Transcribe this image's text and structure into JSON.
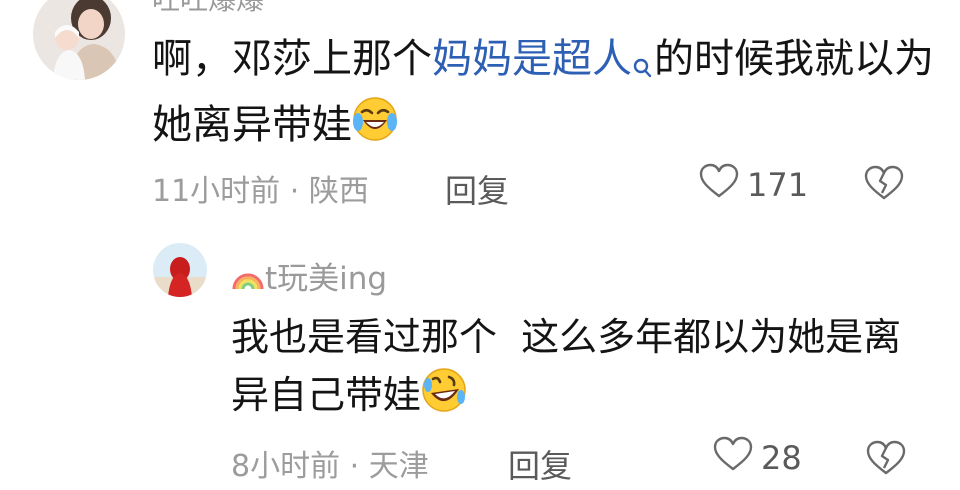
{
  "comments": [
    {
      "username": "吐吐爆爆",
      "text_before": "啊，邓莎上那个",
      "link_text": "妈妈是超人",
      "link_icon": "search-icon",
      "text_after": "的时候我就以为她离异带娃",
      "emoji": "laughing-crying-emoji",
      "time": "11小时前",
      "separator": "·",
      "location": "陕西",
      "reply_label": "回复",
      "like_count": "171",
      "avatar": "mother-and-baby-avatar"
    },
    {
      "username_prefix_icon": "rainbow-icon",
      "username": "t玩美ing",
      "text": "我也是看过那个  这么多年都以为她是离异自己带娃",
      "emoji": "rolling-laughing-emoji",
      "time": "8小时前",
      "separator": "·",
      "location": "天津",
      "reply_label": "回复",
      "like_count": "28",
      "avatar": "red-hooded-figure-avatar"
    }
  ],
  "colors": {
    "link": "#2d5fb5",
    "meta_text": "#9c9c9c",
    "action_text": "#5a5a5a",
    "body_text": "#141414"
  }
}
